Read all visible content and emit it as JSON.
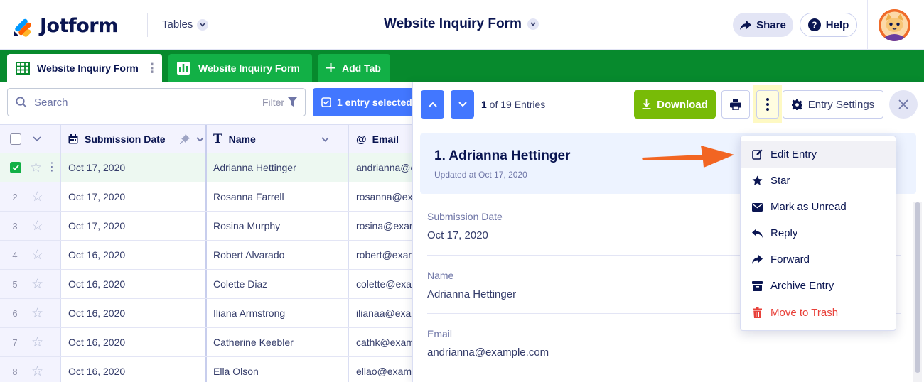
{
  "header": {
    "logo_text": "Jotform",
    "tables_label": "Tables",
    "form_title": "Website Inquiry Form",
    "share_label": "Share",
    "help_label": "Help"
  },
  "tabs": [
    {
      "label": "Website Inquiry Form",
      "icon": "grid-icon"
    },
    {
      "label": "Website Inquiry Form",
      "icon": "chart-icon"
    },
    {
      "label": "Add Tab",
      "icon": "plus-icon"
    }
  ],
  "toolbar": {
    "search_placeholder": "Search",
    "filter_label": "Filter",
    "selection_label": "1 entry selected"
  },
  "table": {
    "columns": [
      "Submission Date",
      "Name",
      "Email"
    ],
    "rows": [
      {
        "num": "1",
        "date": "Oct 17, 2020",
        "name": "Adrianna Hettinger",
        "email": "andrianna@example.com",
        "selected": true
      },
      {
        "num": "2",
        "date": "Oct 17, 2020",
        "name": "Rosanna Farrell",
        "email": "rosanna@example.com",
        "selected": false
      },
      {
        "num": "3",
        "date": "Oct 17, 2020",
        "name": "Rosina Murphy",
        "email": "rosina@example.com",
        "selected": false
      },
      {
        "num": "4",
        "date": "Oct 16, 2020",
        "name": "Robert Alvarado",
        "email": "robert@example.com",
        "selected": false
      },
      {
        "num": "5",
        "date": "Oct 16, 2020",
        "name": "Colette Diaz",
        "email": "colette@example.com",
        "selected": false
      },
      {
        "num": "6",
        "date": "Oct 16, 2020",
        "name": "Iliana Armstrong",
        "email": "ilianaa@example.com",
        "selected": false
      },
      {
        "num": "7",
        "date": "Oct 16, 2020",
        "name": "Catherine Keebler",
        "email": "cathk@example.com",
        "selected": false
      },
      {
        "num": "8",
        "date": "Oct 16, 2020",
        "name": "Ella Olson",
        "email": "ellao@example.com",
        "selected": false
      }
    ]
  },
  "panel": {
    "count_current": "1",
    "count_rest": " of 19 Entries",
    "download_label": "Download",
    "settings_label": "Entry Settings",
    "entry_title": "1. Adrianna Hettinger",
    "entry_updated": "Updated at Oct 17, 2020",
    "fields": [
      {
        "label": "Submission Date",
        "value": "Oct 17, 2020"
      },
      {
        "label": "Name",
        "value": "Adrianna Hettinger"
      },
      {
        "label": "Email",
        "value": "andrianna@example.com"
      }
    ]
  },
  "menu": {
    "items": [
      {
        "label": "Edit Entry",
        "icon": "edit-icon"
      },
      {
        "label": "Star",
        "icon": "star-icon"
      },
      {
        "label": "Mark as Unread",
        "icon": "envelope-icon"
      },
      {
        "label": "Reply",
        "icon": "reply-icon"
      },
      {
        "label": "Forward",
        "icon": "forward-icon"
      },
      {
        "label": "Archive Entry",
        "icon": "archive-icon"
      },
      {
        "label": "Move to Trash",
        "icon": "trash-icon"
      }
    ]
  },
  "colors": {
    "brand_green": "#078a2d",
    "accent_blue": "#4277ff",
    "download_green": "#78bb07",
    "arrow_orange": "#f26522",
    "danger_red": "#e8413a"
  }
}
